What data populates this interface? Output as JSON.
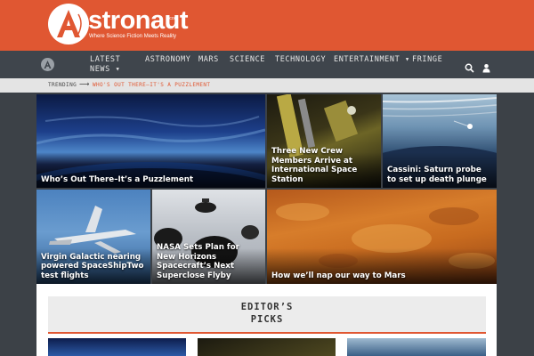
{
  "header": {
    "logo_word": "stronaut",
    "logo_com": ".com",
    "tagline": "Where Science Fiction Meets Reality",
    "brand_color": "#e05732"
  },
  "nav": {
    "items": [
      {
        "label_line1": "LATEST",
        "label_line2": "NEWS ▾"
      },
      {
        "label": "ASTRONOMY"
      },
      {
        "label": "MARS"
      },
      {
        "label": "SCIENCE"
      },
      {
        "label": "TECHNOLOGY"
      },
      {
        "label": "ENTERTAINMENT ▾"
      },
      {
        "label": "FRINGE"
      }
    ],
    "icons": [
      "search-icon",
      "user-icon"
    ]
  },
  "trending": {
    "label": "TRENDING",
    "arrow": "⟶",
    "link": "WHO'S OUT THERE–IT'S A PUZZLEMENT"
  },
  "articles": [
    {
      "title": "Who’s Out There–It’s a Puzzlement"
    },
    {
      "title": "Three New Crew Members Arrive at International Space Station"
    },
    {
      "title": "Cassini: Saturn probe to set up death plunge"
    },
    {
      "title": "Virgin Galactic nearing powered SpaceShipTwo test flights"
    },
    {
      "title": "NASA Sets Plan for New Horizons Spacecraft’s Next Superclose Flyby"
    },
    {
      "title": "How we’ll nap our way to Mars"
    }
  ],
  "editors_picks": {
    "title_line1": "EDITOR’S",
    "title_line2": "PICKS"
  }
}
